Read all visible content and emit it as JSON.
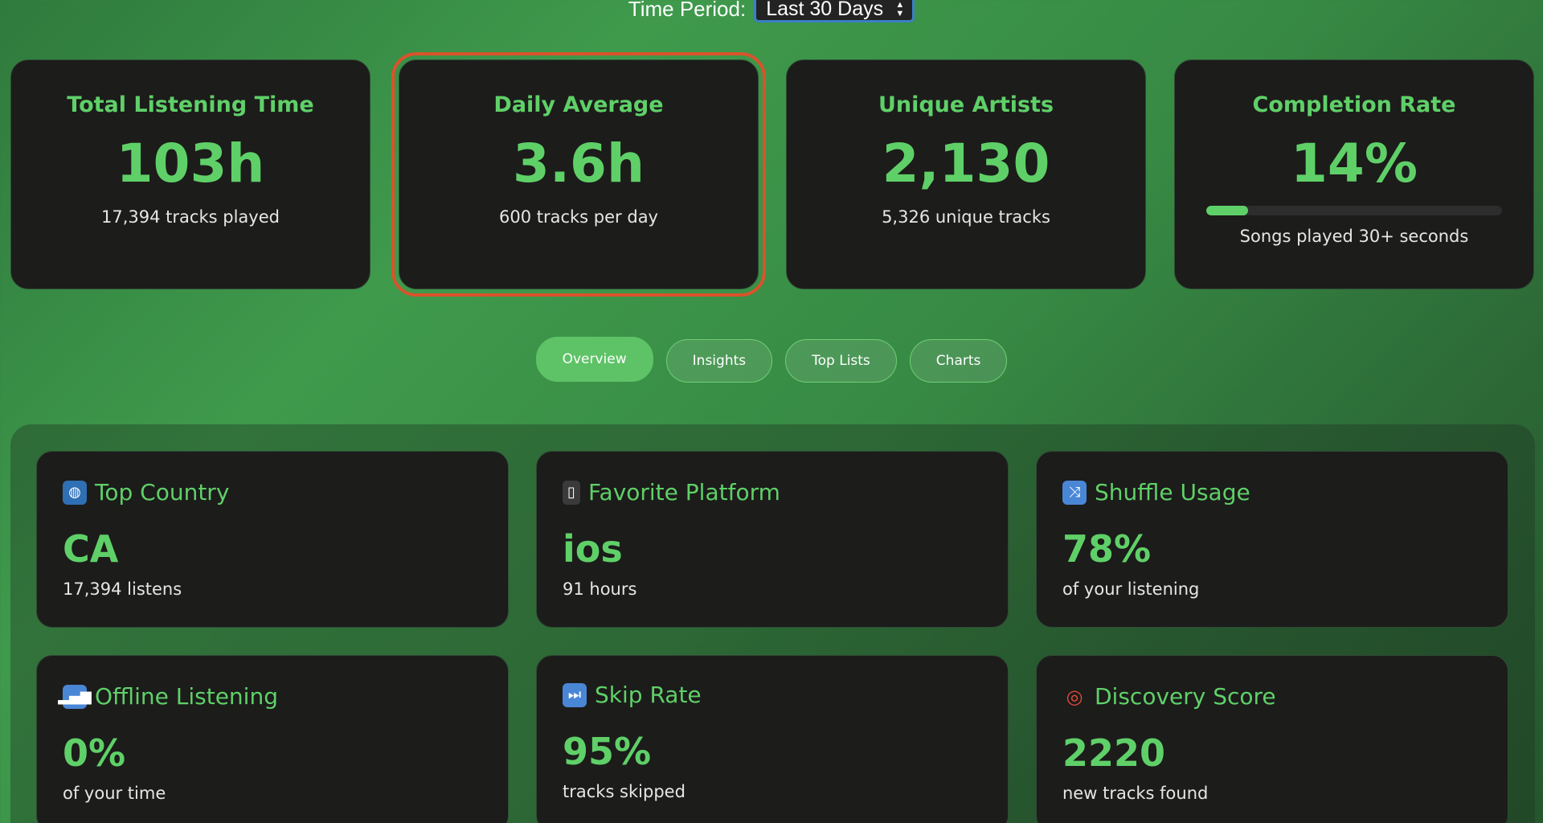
{
  "period": {
    "label": "Time Period:",
    "selected": "Last 30 Days"
  },
  "stats": [
    {
      "title": "Total Listening Time",
      "value": "103h",
      "sub": "17,394 tracks played"
    },
    {
      "title": "Daily Average",
      "value": "3.6h",
      "sub": "600 tracks per day"
    },
    {
      "title": "Unique Artists",
      "value": "2,130",
      "sub": "5,326 unique tracks"
    },
    {
      "title": "Completion Rate",
      "value": "14%",
      "sub": "Songs played 30+ seconds",
      "progress_percent": 14
    }
  ],
  "tabs": [
    {
      "label": "Overview",
      "active": true
    },
    {
      "label": "Insights"
    },
    {
      "label": "Top Lists"
    },
    {
      "label": "Charts"
    }
  ],
  "cards": [
    {
      "icon": "globe-icon",
      "title": "Top Country",
      "value": "CA",
      "sub": "17,394 listens"
    },
    {
      "icon": "phone-icon",
      "title": "Favorite Platform",
      "value": "ios",
      "sub": "91 hours"
    },
    {
      "icon": "shuffle-icon",
      "title": "Shuffle Usage",
      "value": "78%",
      "sub": "of your listening"
    },
    {
      "icon": "signal-icon",
      "title": "Offline Listening",
      "value": "0%",
      "sub": "of your time"
    },
    {
      "icon": "skip-forward-icon",
      "title": "Skip Rate",
      "value": "95%",
      "sub": "tracks skipped"
    },
    {
      "icon": "target-icon",
      "title": "Discovery Score",
      "value": "2220",
      "sub": "new tracks found"
    }
  ],
  "colors": {
    "accent": "#5fd068",
    "card_bg": "#1c1c1b",
    "highlight_outline": "#d9532b"
  }
}
